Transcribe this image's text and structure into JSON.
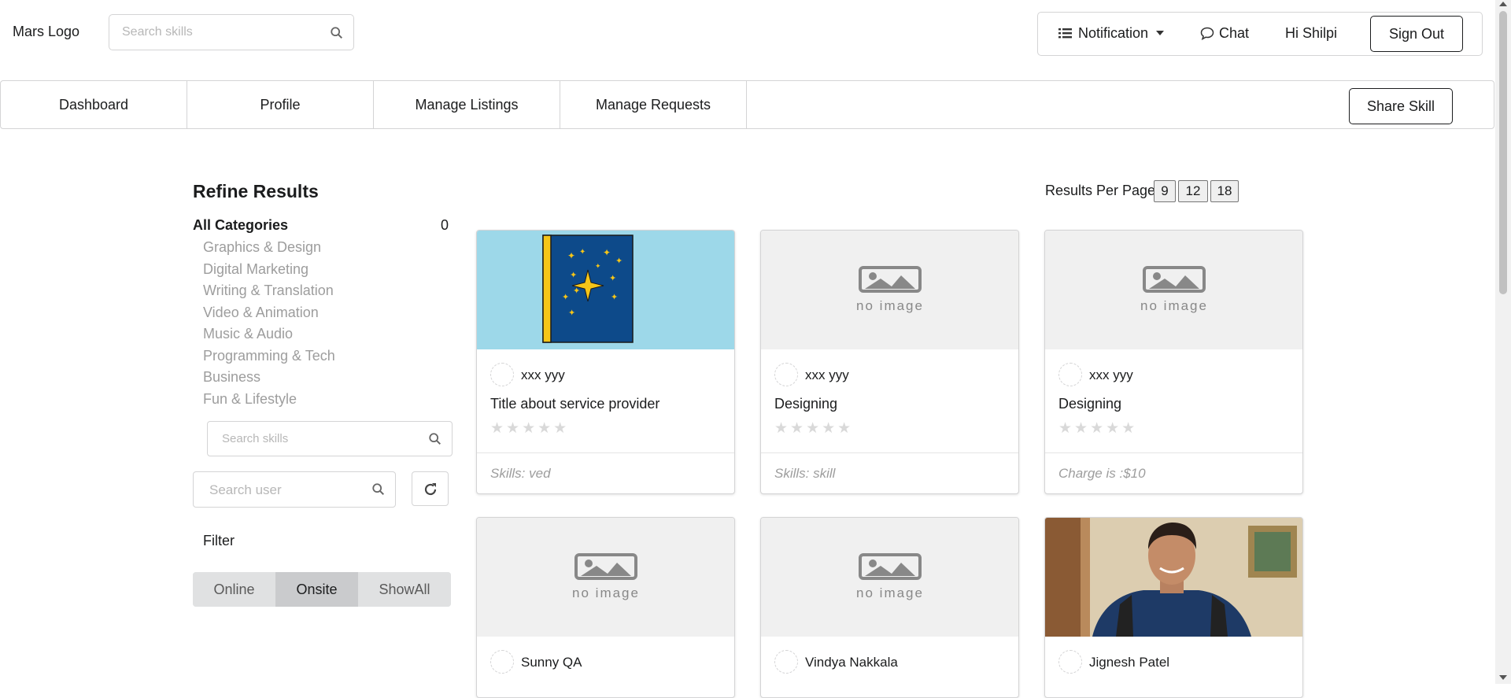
{
  "header": {
    "logo": "Mars Logo",
    "search_placeholder": "Search skills",
    "notification": "Notification",
    "chat": "Chat",
    "greeting": "Hi Shilpi",
    "sign_out": "Sign Out"
  },
  "nav": {
    "items": [
      "Dashboard",
      "Profile",
      "Manage Listings",
      "Manage Requests"
    ],
    "share_skill": "Share Skill"
  },
  "sidebar": {
    "title": "Refine Results",
    "all_categories": "All Categories",
    "all_categories_count": "0",
    "categories": [
      "Graphics & Design",
      "Digital Marketing",
      "Writing & Translation",
      "Video & Animation",
      "Music & Audio",
      "Programming & Tech",
      "Business",
      "Fun & Lifestyle"
    ],
    "skill_search_placeholder": "Search skills",
    "user_search_placeholder": "Search user",
    "filter_label": "Filter",
    "filter_options": [
      "Online",
      "Onsite",
      "ShowAll"
    ],
    "filter_selected": "Onsite"
  },
  "results": {
    "per_page_label": "Results Per Page :",
    "per_page_options": [
      "9",
      "12",
      "18"
    ]
  },
  "no_image_text": "no image",
  "cards": [
    {
      "user": "xxx yyy",
      "title": "Title about service provider",
      "footer": "Skills: ved",
      "image": "book-stars",
      "rating": 0
    },
    {
      "user": "xxx yyy",
      "title": "Designing",
      "footer": "Skills: skill",
      "image": "no-image",
      "rating": 0
    },
    {
      "user": "xxx yyy",
      "title": "Designing",
      "footer": "Charge is :$10",
      "image": "no-image",
      "rating": 0
    },
    {
      "user": "Sunny QA",
      "image": "no-image"
    },
    {
      "user": "Vindya Nakkala",
      "image": "no-image"
    },
    {
      "user": "Jignesh Patel",
      "image": "person-photo"
    }
  ],
  "colors": {
    "border": "#d4d4d5",
    "muted_text": "#9d9d9d",
    "book_bg": "#9dd8e9",
    "book_cover": "#0d4a8a",
    "star_yellow": "#f5c518"
  }
}
